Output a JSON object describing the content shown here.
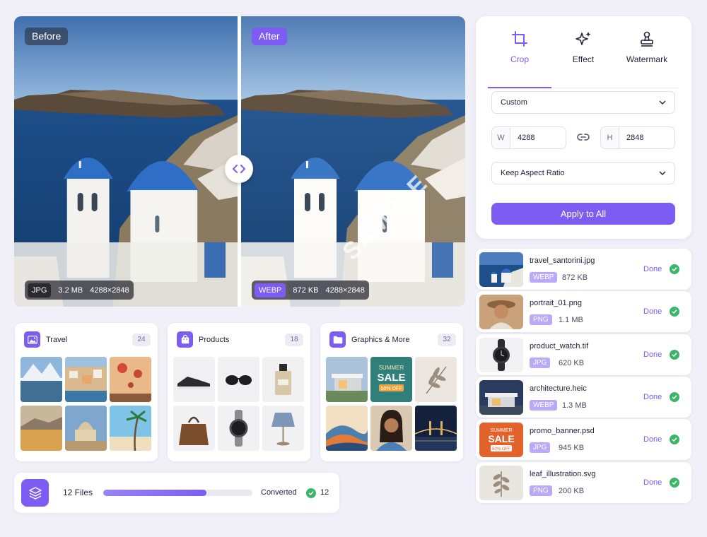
{
  "comparison": {
    "before": {
      "label": "Before",
      "format": "JPG",
      "size": "3.2 MB",
      "dimensions": "4288×2848"
    },
    "after": {
      "label": "After",
      "format": "WEBP",
      "size": "872 KB",
      "dimensions": "4288×2848",
      "watermark": "SAMPLE"
    }
  },
  "panel": {
    "tabs": [
      {
        "label": "Crop",
        "icon": "crop-icon",
        "active": true
      },
      {
        "label": "Effect",
        "icon": "sparkle-icon",
        "active": false
      },
      {
        "label": "Watermark",
        "icon": "stamp-icon",
        "active": false
      }
    ],
    "preset": "Custom",
    "width_label": "W",
    "width_value": "4288",
    "height_label": "H",
    "height_value": "2848",
    "aspect_option": "Keep Aspect Ratio",
    "apply_label": "Apply to All"
  },
  "files": [
    {
      "name": "travel_santorini.jpg",
      "format": "WEBP",
      "size": "872 KB",
      "status": "Done"
    },
    {
      "name": "portrait_01.png",
      "format": "PNG",
      "size": "1.1 MB",
      "status": "Done"
    },
    {
      "name": "product_watch.tif",
      "format": "JPG",
      "size": "620 KB",
      "status": "Done"
    },
    {
      "name": "architecture.heic",
      "format": "WEBP",
      "size": "1.3 MB",
      "status": "Done"
    },
    {
      "name": "promo_banner.psd",
      "format": "JPG",
      "size": "945 KB",
      "status": "Done"
    },
    {
      "name": "leaf_illustration.svg",
      "format": "PNG",
      "size": "200 KB",
      "status": "Done"
    }
  ],
  "collections": [
    {
      "title": "Travel",
      "count": "24",
      "icon": "image-icon"
    },
    {
      "title": "Products",
      "count": "18",
      "icon": "shopping-bag-icon"
    },
    {
      "title": "Graphics & More",
      "count": "32",
      "icon": "folder-icon"
    }
  ],
  "promo_thumb": {
    "line1": "SUMMER",
    "line2": "SALE",
    "line3": "50% OFF"
  },
  "progress": {
    "files_label": "12 Files",
    "fraction": 0.69,
    "converted_label": "Converted",
    "converted_count": "12"
  },
  "colors": {
    "accent": "#7c5cf2",
    "success": "#3bb56a",
    "badge": "#b9a9f8"
  }
}
